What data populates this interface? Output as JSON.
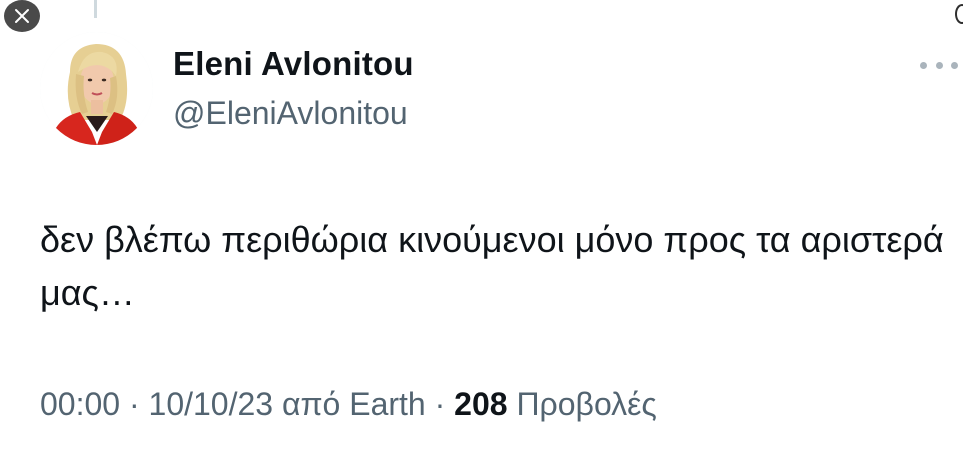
{
  "colors": {
    "text_primary": "#0f1419",
    "text_secondary": "#536471",
    "close_button_bg": "#4a4a4a",
    "avatar_jacket": "#d7261e",
    "avatar_hair": "#e6cf93"
  },
  "icons": {
    "close": "close-icon",
    "more": "more-icon",
    "avatar": "profile-photo"
  },
  "user": {
    "display_name": "Eleni Avlonitou",
    "handle": "@EleniAvlonitou"
  },
  "tweet": {
    "text": "δεν βλέπω περιθώρια κινούμενοι μόνο προς τα αριστερά μας…"
  },
  "meta": {
    "time": "00:00",
    "separator": " · ",
    "date": "10/10/23",
    "source": " από Earth",
    "views_count": "208",
    "views_label": " Προβολές"
  }
}
